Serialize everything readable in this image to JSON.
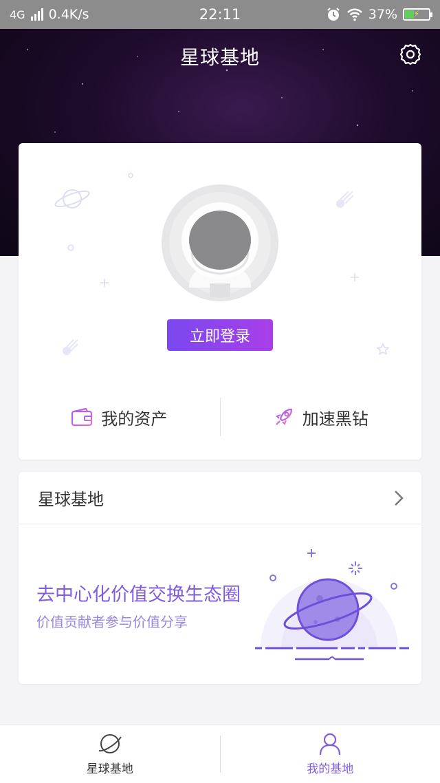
{
  "status_bar": {
    "network": "4G",
    "speed": "0.4K/s",
    "time": "22:11",
    "battery": "37%",
    "battery_level_percent": 37
  },
  "header": {
    "title": "星球基地",
    "settings_icon": "gear-icon"
  },
  "profile": {
    "login_label": "立即登录",
    "actions": [
      {
        "label": "我的资产",
        "icon": "wallet-icon"
      },
      {
        "label": "加速黑钻",
        "icon": "rocket-icon"
      }
    ]
  },
  "planet_section": {
    "title": "星球基地",
    "slogan": "去中心化价值交换生态圈",
    "subtitle": "价值贡献者参与价值分享"
  },
  "bottom_nav": {
    "items": [
      {
        "label": "星球基地",
        "icon": "planet-icon",
        "active": false
      },
      {
        "label": "我的基地",
        "icon": "user-icon",
        "active": true
      }
    ]
  },
  "colors": {
    "accent": "#7f5ce0",
    "login_gradient_start": "#7a48f0",
    "login_gradient_end": "#a93fe8",
    "hero_bg": "#1d0b2b"
  }
}
